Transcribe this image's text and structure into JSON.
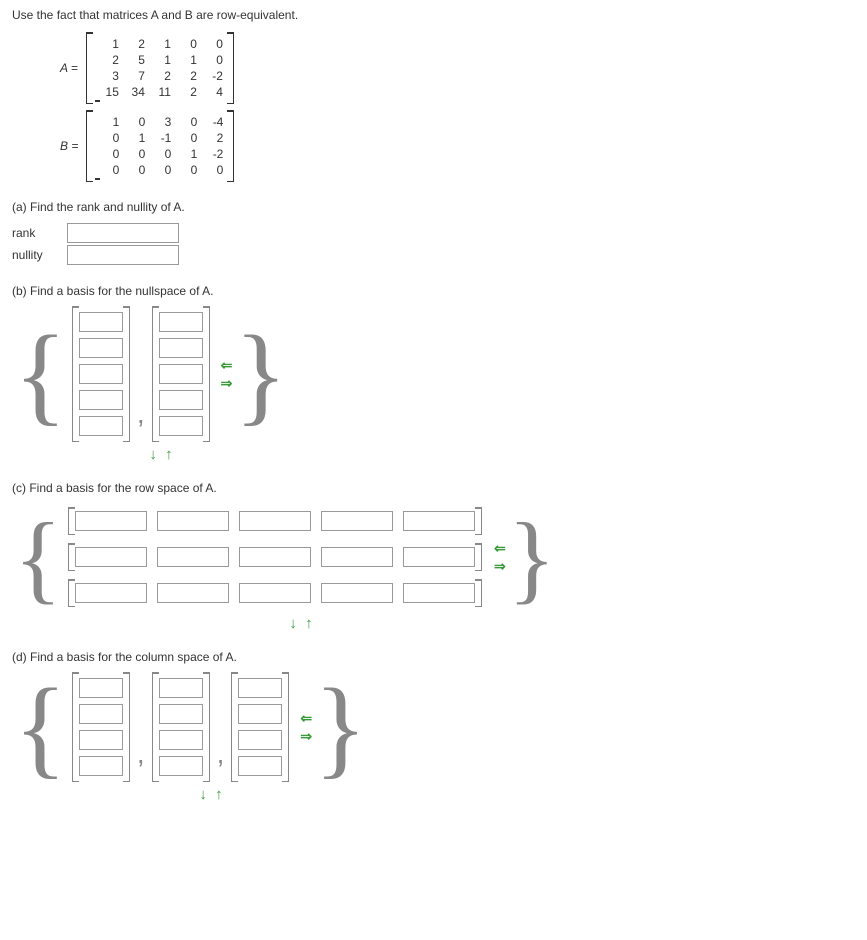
{
  "prompt": "Use the fact that matrices A and B are row-equivalent.",
  "matrices": {
    "A": {
      "label": "A =",
      "rows": [
        [
          "1",
          "2",
          "1",
          "0",
          "0"
        ],
        [
          "2",
          "5",
          "1",
          "1",
          "0"
        ],
        [
          "3",
          "7",
          "2",
          "2",
          "-2"
        ],
        [
          "15",
          "34",
          "11",
          "2",
          "4"
        ]
      ]
    },
    "B": {
      "label": "B =",
      "rows": [
        [
          "1",
          "0",
          "3",
          "0",
          "-4"
        ],
        [
          "0",
          "1",
          "-1",
          "0",
          "2"
        ],
        [
          "0",
          "0",
          "0",
          "1",
          "-2"
        ],
        [
          "0",
          "0",
          "0",
          "0",
          "0"
        ]
      ]
    }
  },
  "parts": {
    "a": {
      "text": "(a) Find the rank and nullity of A.",
      "rank_label": "rank",
      "nullity_label": "nullity"
    },
    "b": {
      "text": "(b) Find a basis for the nullspace of A."
    },
    "c": {
      "text": "(c) Find a basis for the row space of A."
    },
    "d": {
      "text": "(d) Find a basis for the column space of A."
    }
  },
  "icons": {
    "updown": "↓ ↑",
    "left": "⇐",
    "right": "⇒"
  }
}
